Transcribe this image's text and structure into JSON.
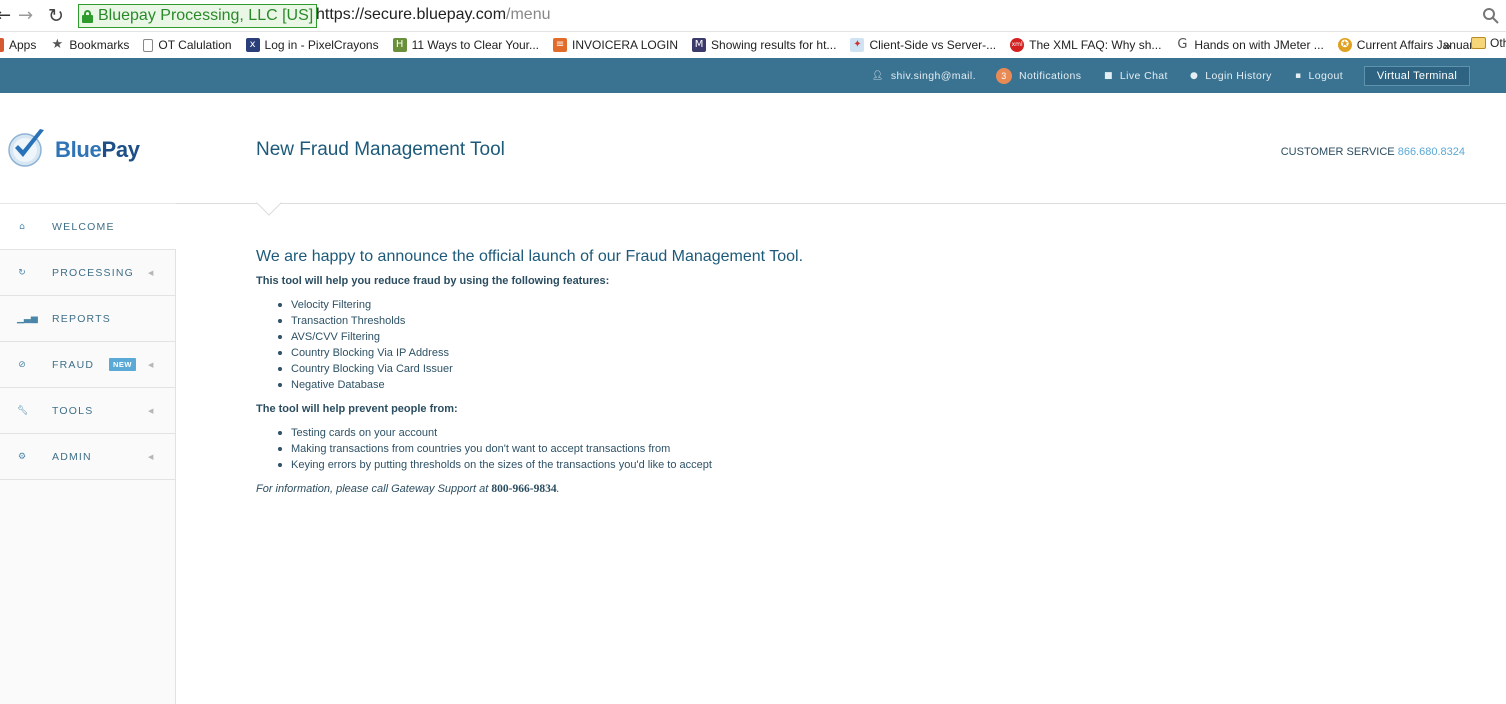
{
  "browser": {
    "ev_label": "Bluepay Processing, LLC [US]",
    "url_scheme_host": "https://secure.bluepay.com",
    "url_path": "/menu",
    "bookmarks": [
      {
        "icon": "apps-icon",
        "label": "Apps"
      },
      {
        "icon": "star-icon",
        "label": "Bookmarks"
      },
      {
        "icon": "page-icon",
        "label": "OT Calulation"
      },
      {
        "icon": "pixelcrayons-icon",
        "label": "Log in - PixelCrayons"
      },
      {
        "icon": "h-icon",
        "label": "11 Ways to Clear Your..."
      },
      {
        "icon": "invoicera-icon",
        "label": "INVOICERA LOGIN"
      },
      {
        "icon": "m-icon",
        "label": "Showing results for ht..."
      },
      {
        "icon": "client-icon",
        "label": "Client-Side vs Server-..."
      },
      {
        "icon": "xml-icon",
        "label": "The XML FAQ: Why sh..."
      },
      {
        "icon": "g-icon",
        "label": "Hands on with JMeter ..."
      },
      {
        "icon": "award-icon",
        "label": "Current Affairs Januar..."
      }
    ],
    "more": "»",
    "other": "Oth"
  },
  "topbar": {
    "user": "shiv.singh@mail.",
    "notif_count": "3",
    "notifications": "Notifications",
    "live_chat": "Live Chat",
    "login_history": "Login History",
    "logout": "Logout",
    "virtual_terminal": "Virtual Terminal"
  },
  "logo": {
    "blue": "Blue",
    "pay": "Pay"
  },
  "nav": [
    {
      "label": "WELCOME",
      "icon": "home-icon",
      "active": true
    },
    {
      "label": "PROCESSING",
      "icon": "refresh-icon"
    },
    {
      "label": "REPORTS",
      "icon": "bars-icon"
    },
    {
      "label": "FRAUD",
      "icon": "ban-icon",
      "badge": "NEW"
    },
    {
      "label": "TOOLS",
      "icon": "wrench-icon"
    },
    {
      "label": "ADMIN",
      "icon": "gear-icon"
    }
  ],
  "header": {
    "title": "New Fraud Management Tool",
    "cs_label": "CUSTOMER SERVICE",
    "cs_phone": "866.680.8324"
  },
  "content": {
    "lead": "We are happy to announce the official launch of our Fraud Management Tool.",
    "features_heading": "This tool will help you reduce fraud by using the following features:",
    "features": [
      "Velocity Filtering",
      "Transaction Thresholds",
      "AVS/CVV Filtering",
      "Country Blocking Via IP Address",
      "Country Blocking Via Card Issuer",
      "Negative Database"
    ],
    "prevent_heading": "The tool will help prevent people from:",
    "prevent": [
      "Testing cards on your account",
      "Making transactions from countries you don't want to accept transactions from",
      "Keying errors by putting thresholds on the sizes of the transactions you'd like to accept"
    ],
    "info_text": "For information, please call Gateway Support at",
    "info_phone": "800-966-9834",
    "info_end": "."
  }
}
